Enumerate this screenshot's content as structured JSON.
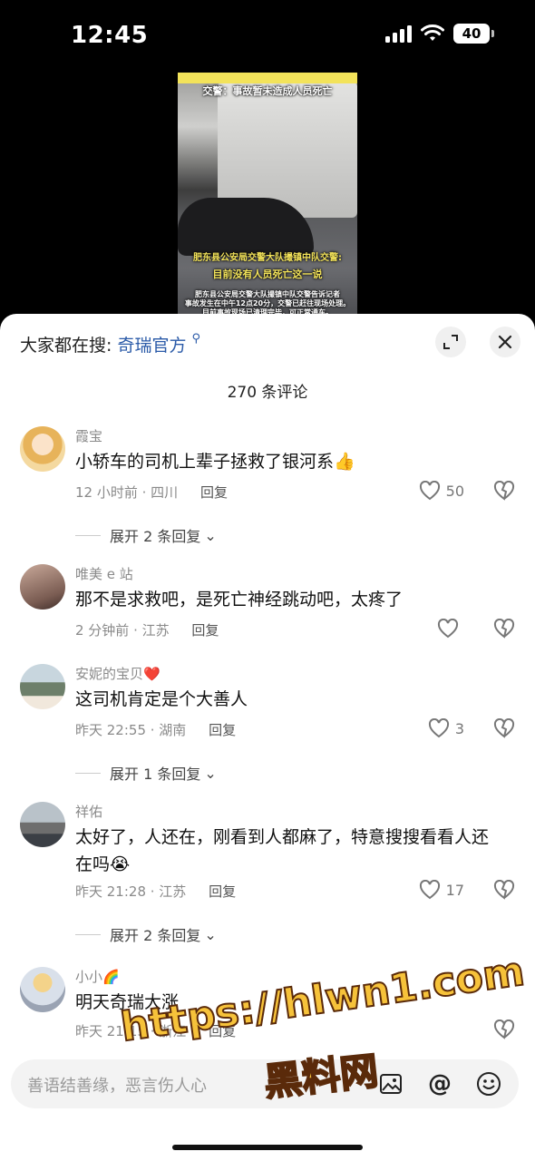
{
  "status_bar": {
    "time": "12:45",
    "battery": "40"
  },
  "video": {
    "caption_top": "交警：事故暂未造成人员死亡",
    "caption_mid1": "肥东县公安局交警大队撮镇中队交警:",
    "caption_mid2": "目前没有人员死亡这一说",
    "caption_small1": "肥东县公安局交警大队撮镇中队交警告诉记者",
    "caption_small2": "事故发生在中午12点20分，交警已赶往现场处理。",
    "caption_small3": "目前事故现场已清理完毕，可正常通车。"
  },
  "search": {
    "prefix": "大家都在搜:",
    "query": "奇瑞官方"
  },
  "comment_count": "270 条评论",
  "comments": [
    {
      "user": "霞宝",
      "text": "小轿车的司机上辈子拯救了银河系👍",
      "time_loc": "12 小时前 · 四川",
      "reply": "回复",
      "likes": "50",
      "expand": "展开 2 条回复"
    },
    {
      "user": "唯美 e 站",
      "text": "那不是求救吧，是死亡神经跳动吧，太疼了",
      "time_loc": "2 分钟前 · 江苏",
      "reply": "回复",
      "likes": ""
    },
    {
      "user": "安妮的宝贝❤️",
      "text": "这司机肯定是个大善人",
      "time_loc": "昨天 22:55 · 湖南",
      "reply": "回复",
      "likes": "3",
      "expand": "展开 1 条回复"
    },
    {
      "user": "祥佑",
      "text": "太好了，人还在，刚看到人都麻了，特意搜搜看看人还在吗😭",
      "time_loc": "昨天 21:28 · 江苏",
      "reply": "回复",
      "likes": "17",
      "expand": "展开 2 条回复"
    },
    {
      "user": "小小🌈",
      "text": "明天奇瑞大涨",
      "time_loc": "昨天 21:15 · 浙江",
      "reply": "回复",
      "likes": ""
    }
  ],
  "input": {
    "placeholder": "善语结善缘，恶言伤人心"
  },
  "watermark": {
    "line1": "https://hlwn1.com",
    "line2": "黑料网"
  }
}
